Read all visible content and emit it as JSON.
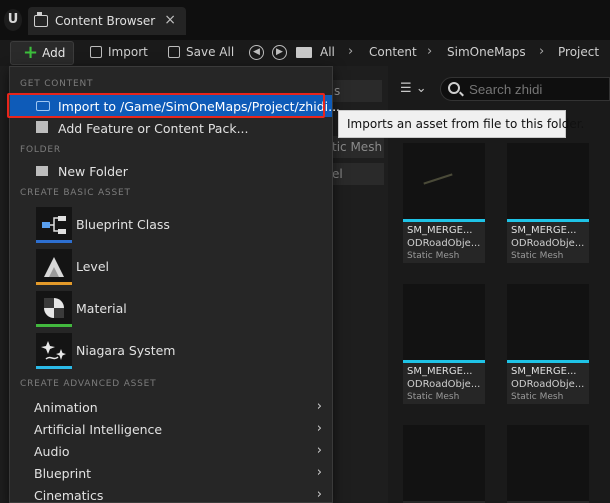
{
  "window": {
    "logo_letter": "U",
    "tab_title": "Content Browser",
    "tab_close": "×"
  },
  "toolbar": {
    "add_label": "Add",
    "import_label": "Import",
    "save_all_label": "Save All",
    "breadcrumbs": [
      "All",
      "Content",
      "SimOneMaps",
      "Project"
    ]
  },
  "search": {
    "placeholder": "Search zhidi"
  },
  "background": {
    "chips": [
      "s",
      "tic Mesh",
      "el"
    ]
  },
  "assets": [
    {
      "name": "SM_MERGE...",
      "name2": "ODRoadObje...",
      "type": "Static Mesh"
    },
    {
      "name": "SM_MERGE...",
      "name2": "ODRoadObje...",
      "type": "Static Mesh"
    },
    {
      "name": "SM_MERGE...",
      "name2": "ODRoadObje...",
      "type": "Static Mesh"
    },
    {
      "name": "SM_MERGE...",
      "name2": "ODRoadObje...",
      "type": "Static Mesh"
    }
  ],
  "menu": {
    "sections": {
      "get_content": "GET CONTENT",
      "folder": "FOLDER",
      "basic": "CREATE BASIC ASSET",
      "advanced": "CREATE ADVANCED ASSET"
    },
    "import_to": "Import to /Game/SimOneMaps/Project/zhidi...",
    "add_feature": "Add Feature or Content Pack...",
    "new_folder": "New Folder",
    "basic_assets": [
      "Blueprint Class",
      "Level",
      "Material",
      "Niagara System"
    ],
    "advanced_assets": [
      "Animation",
      "Artificial Intelligence",
      "Audio",
      "Blueprint",
      "Cinematics"
    ]
  },
  "tooltip": "Imports an asset from file to this folder.",
  "colors": {
    "accent_blue": "#0e5bb8",
    "highlight_border": "#e8251b",
    "asset_bar": "#1fc3e6"
  }
}
